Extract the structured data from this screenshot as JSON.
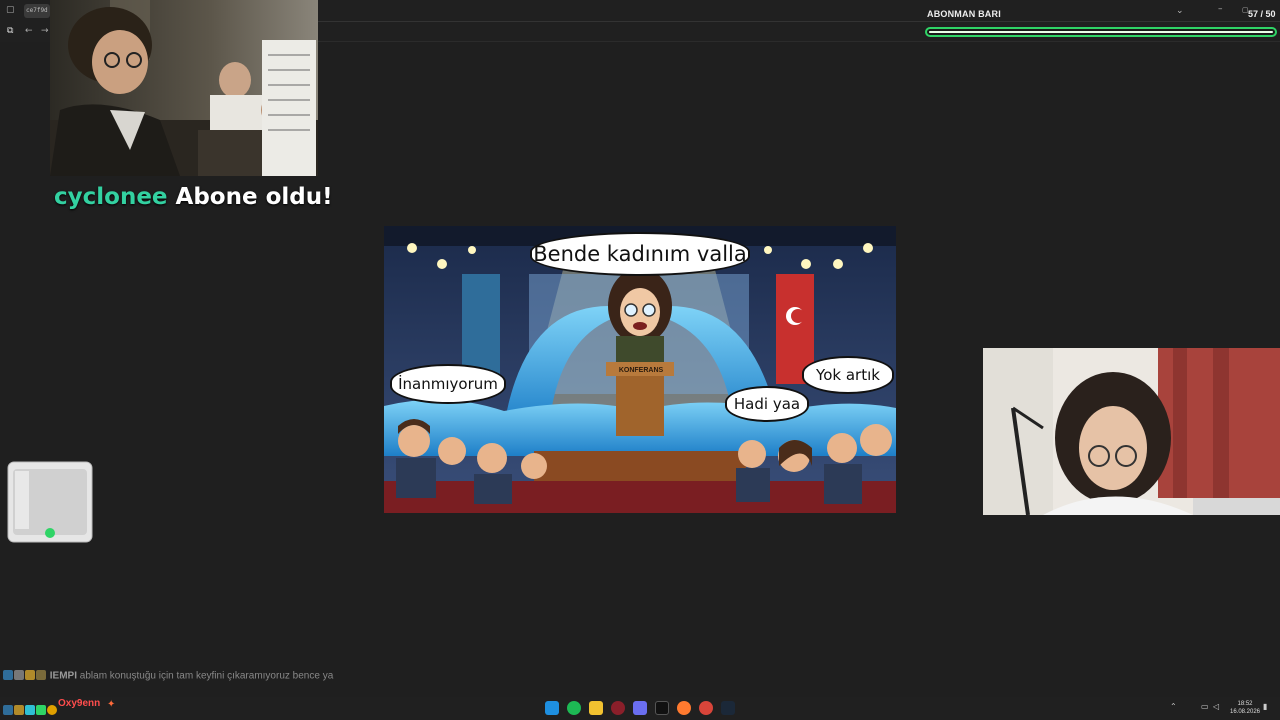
{
  "browser": {
    "tab_title": "ce7f9d",
    "icons": [
      "tab-icon",
      "new-tab-icon",
      "back-icon",
      "forward-icon"
    ]
  },
  "alert": {
    "username": "cyclonee",
    "message": "Abone oldu!"
  },
  "sub_bar": {
    "title": "ABONMAN BARI",
    "count": "57 / 50",
    "progress": 1.0,
    "accent": "#2fd466"
  },
  "meme": {
    "main_bubble": "Bende kadınım valla",
    "left_bubble": "İnanmıyorum",
    "right_bubble_1": "Hadi yaa",
    "right_bubble_2": "Yok artık",
    "podium_label": "KONFERANS"
  },
  "chat": {
    "user": "IEMPI",
    "message": "ablam konuştuğu için tam keyfini çıkaramıyoruz bence ya",
    "user2": "Oxy9enn"
  },
  "taskbar": {
    "time": "18:52",
    "date": "16.08.2026",
    "icons": [
      "windows-start-icon",
      "spotify-icon",
      "file-explorer-icon",
      "game-icon",
      "discord-icon",
      "terminal-icon",
      "firefox-icon",
      "chrome-icon",
      "steam-icon"
    ]
  },
  "colors": {
    "background": "#1f1f1f",
    "sub_username": "#33d1a1",
    "chat_name_red": "#ff4d4d"
  }
}
